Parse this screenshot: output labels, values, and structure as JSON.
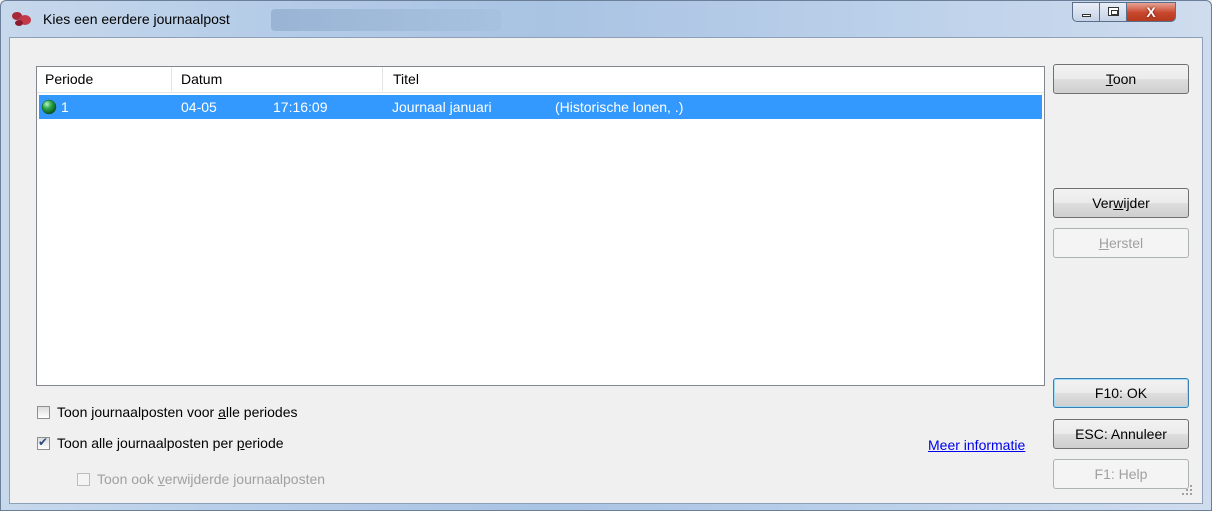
{
  "window": {
    "title": "Kies een eerdere journaalpost",
    "controls": {
      "close_glyph": "X"
    }
  },
  "list": {
    "columns": [
      "Periode",
      "Datum",
      "Titel"
    ],
    "rows": [
      {
        "periode": "1",
        "datum": "04-05",
        "tijd": "17:16:09",
        "titel": "Journaal januari",
        "omschrijving": "(Historische lonen, .)",
        "selected": true,
        "status_color": "#1f9a3a"
      }
    ]
  },
  "buttons": {
    "toon": {
      "pre": "",
      "accel": "T",
      "post": "oon"
    },
    "verwijder": {
      "pre": "Ver",
      "accel": "w",
      "post": "ijder"
    },
    "herstel": {
      "pre": "",
      "accel": "H",
      "post": "erstel"
    },
    "ok": "F10: OK",
    "annuleer": "ESC: Annuleer",
    "help": "F1: Help"
  },
  "options": {
    "alle_periodes": {
      "pre": "Toon journaalposten voor ",
      "accel": "a",
      "post": "lle periodes",
      "checked": false
    },
    "per_periode": {
      "pre": "Toon alle journaalposten per ",
      "accel": "p",
      "post": "eriode",
      "checked": true
    },
    "verwijderde": {
      "pre": "Toon ook ",
      "accel": "v",
      "post": "erwijderde journaalposten",
      "checked": false,
      "disabled": true
    }
  },
  "link": {
    "meer_info": "Meer informatie"
  },
  "colors": {
    "selection": "#3399ff",
    "link": "#0000ee"
  }
}
